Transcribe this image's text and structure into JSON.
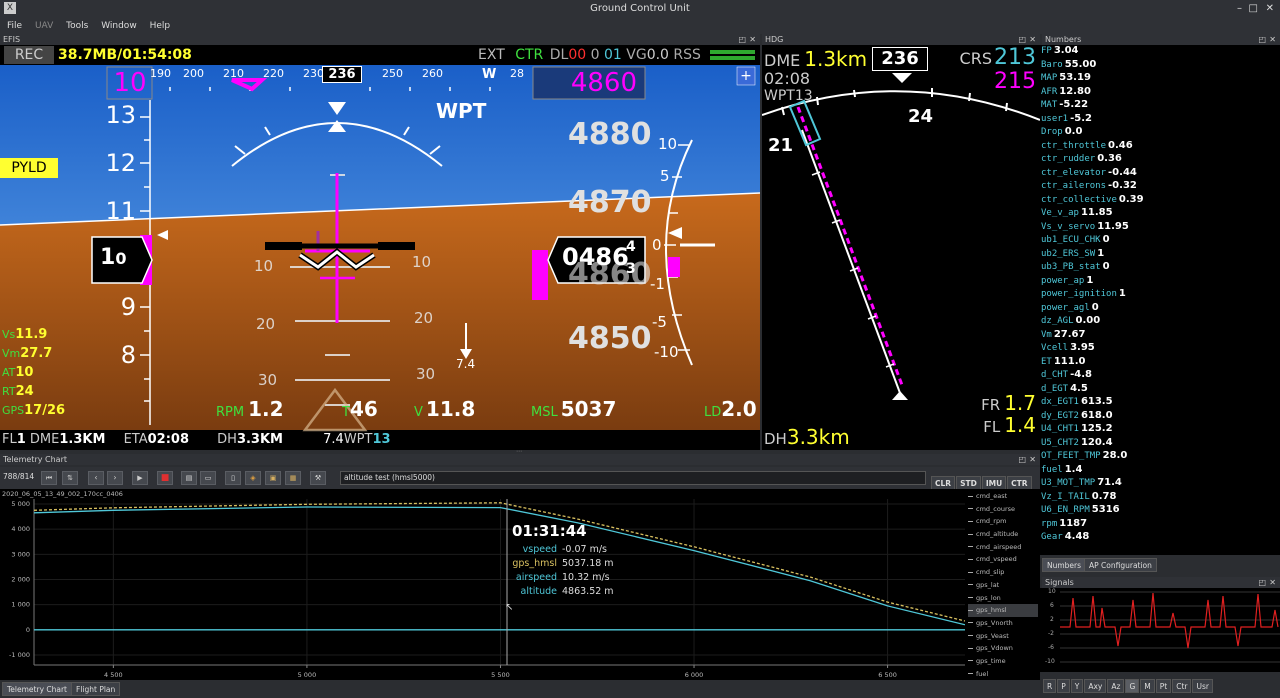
{
  "window": {
    "title": "Ground Control Unit"
  },
  "menu": [
    "File",
    "UAV",
    "Tools",
    "Window",
    "Help"
  ],
  "efis": {
    "panel_title": "EFIS",
    "rec": "REC",
    "rec_info": "38.7MB/01:54:08",
    "status": {
      "ext": "EXT",
      "ctr": "CTR",
      "dl": "DL",
      "dl_val": "00",
      "dl_a": "0",
      "dl_b": "01",
      "vg": "VG",
      "vg_val": "0.0",
      "rss": "RSS"
    },
    "heading_box": "236",
    "course_box": "10",
    "alt_box": "4860",
    "hdg_ticks": [
      "190",
      "200",
      "210",
      "220",
      "230",
      "250",
      "260",
      "W",
      "28"
    ],
    "wpt_label": "WPT",
    "pyld": "PYLD",
    "speed_tape": [
      "13",
      "12",
      "11",
      "9",
      "8"
    ],
    "speed_box_a": "1",
    "speed_box_b": "0",
    "alt_tape": [
      "4880",
      "4870",
      "4860",
      "4850"
    ],
    "alt_box_main": "0486",
    "alt_box_top": "4",
    "alt_box_bot": "3",
    "pitch_labels": [
      "10",
      "10",
      "20",
      "20",
      "30",
      "30"
    ],
    "vs_scale": [
      "10",
      "5",
      "0",
      "-1",
      "-5",
      "-10"
    ],
    "wind": "7.4",
    "left_vals": [
      {
        "k": "Vs",
        "v": "11.9"
      },
      {
        "k": "Vm",
        "v": "27.7"
      },
      {
        "k": "AT",
        "v": "10"
      },
      {
        "k": "RT",
        "v": "24"
      },
      {
        "k": "GPS",
        "v": "17/26"
      }
    ],
    "rpm_label": "RPM",
    "rpm": "1.2",
    "t_label": "T",
    "t_val": "46",
    "v_label": "V",
    "v_val": "11.8",
    "msl_label": "MSL",
    "msl": "5037",
    "ld_label": "LD",
    "ld": "2.0",
    "bottom": {
      "fl": "FL",
      "fl_val": "1",
      "dme": "DME",
      "dme_val": "1.3KM",
      "eta": "ETA",
      "eta_val": "02:08",
      "dh": "DH",
      "dh_val": "3.3KM",
      "wind": "7.4",
      "wpt": "WPT",
      "wpt_val": "13"
    }
  },
  "hdg": {
    "panel_title": "HDG",
    "dme_label": "DME",
    "dme_val": "1.3km",
    "time": "02:08",
    "wpt": "WPT13",
    "heading": "236",
    "crs_label": "CRS",
    "crs": "213",
    "crs2": "215",
    "tick_24": "24",
    "tick_21": "21",
    "fr_label": "FR",
    "fr": "1.7",
    "fl_label": "FL",
    "fl": "1.4",
    "dh_label": "DH",
    "dh": "3.3km"
  },
  "numbers": {
    "panel_title": "Numbers",
    "items": [
      {
        "k": "FP",
        "v": "3.04"
      },
      {
        "k": "Baro",
        "v": "55.00"
      },
      {
        "k": "MAP",
        "v": "53.19"
      },
      {
        "k": "AFR",
        "v": "12.80"
      },
      {
        "k": "MAT",
        "v": "-5.22"
      },
      {
        "k": "user1",
        "v": "-5.2"
      },
      {
        "k": "Drop",
        "v": "0.0"
      },
      {
        "k": "ctr_throttle",
        "v": "0.46"
      },
      {
        "k": "ctr_rudder",
        "v": "0.36"
      },
      {
        "k": "ctr_elevator",
        "v": "-0.44"
      },
      {
        "k": "ctr_ailerons",
        "v": "-0.32"
      },
      {
        "k": "ctr_collective",
        "v": "0.39"
      },
      {
        "k": "Ve_v_ap",
        "v": "11.85"
      },
      {
        "k": "Vs_v_servo",
        "v": "11.95"
      },
      {
        "k": "ub1_ECU_CHK",
        "v": "0"
      },
      {
        "k": "ub2_ERS_SW",
        "v": "1"
      },
      {
        "k": "ub3_PB_stat",
        "v": "0"
      },
      {
        "k": "power_ap",
        "v": "1"
      },
      {
        "k": "power_ignition",
        "v": "1"
      },
      {
        "k": "power_agl",
        "v": "0"
      },
      {
        "k": "dz_AGL",
        "v": "0.00"
      },
      {
        "k": "Vm",
        "v": "27.67"
      },
      {
        "k": "Vcell",
        "v": "3.95"
      },
      {
        "k": "ET",
        "v": "111.0"
      },
      {
        "k": "d_CHT",
        "v": "-4.8"
      },
      {
        "k": "d_EGT",
        "v": "4.5"
      },
      {
        "k": "dx_EGT1",
        "v": "613.5"
      },
      {
        "k": "dy_EGT2",
        "v": "618.0"
      },
      {
        "k": "U4_CHT1",
        "v": "125.2"
      },
      {
        "k": "U5_CHT2",
        "v": "120.4"
      },
      {
        "k": "OT_FEET_TMP",
        "v": "28.0"
      },
      {
        "k": "fuel",
        "v": "1.4"
      },
      {
        "k": "U3_MOT_TMP",
        "v": "71.4"
      },
      {
        "k": "Vz_I_TAIL",
        "v": "0.78"
      },
      {
        "k": "U6_EN_RPM",
        "v": "5316"
      },
      {
        "k": "rpm",
        "v": "1187"
      },
      {
        "k": "Gear",
        "v": "4.48"
      }
    ],
    "tabs": [
      "Numbers",
      "AP Configuration"
    ]
  },
  "signals": {
    "panel_title": "Signals",
    "y_ticks": [
      "10",
      "6",
      "2",
      "-2",
      "-6",
      "-10"
    ],
    "buttons": [
      "R",
      "P",
      "Y",
      "Axy",
      "Az",
      "G",
      "M",
      "Pt",
      "Ctr",
      "Usr"
    ]
  },
  "telemetry": {
    "panel_title": "Telemetry Chart",
    "counter": "788/814",
    "search_value": "altitude test (hmsl5000)",
    "mode_buttons": [
      "CLR",
      "STD",
      "IMU",
      "CTR"
    ],
    "file_name": "2020_06_05_13_49_002_170cc_0406",
    "cursor_time": "01:31:44",
    "tooltip": [
      {
        "k": "vspeed",
        "v": "-0.07 m/s",
        "c": "#4fc7d8"
      },
      {
        "k": "gps_hmsl",
        "v": "5037.18 m",
        "c": "#d8c060"
      },
      {
        "k": "airspeed",
        "v": "10.32 m/s",
        "c": "#4fc7d8"
      },
      {
        "k": "altitude",
        "v": "4863.52 m",
        "c": "#4fc7d8"
      }
    ],
    "legend": [
      "cmd_east",
      "cmd_course",
      "cmd_rpm",
      "cmd_altitude",
      "cmd_airspeed",
      "cmd_vspeed",
      "cmd_slip",
      "gps_lat",
      "gps_lon",
      "gps_hmsl",
      "gps_Vnorth",
      "gps_Veast",
      "gps_Vdown",
      "gps_time",
      "fuel"
    ],
    "bottom_tabs": [
      "Telemetry Chart",
      "Flight Plan"
    ]
  },
  "chart_data": {
    "type": "line",
    "xlabel": "",
    "ylabel": "",
    "x_ticks": [
      "4 500",
      "5 000",
      "5 500",
      "6 000",
      "6 500"
    ],
    "y_ticks": [
      "5 000",
      "4 000",
      "3 000",
      "2 000",
      "1 000",
      "0",
      "-1 000"
    ],
    "xlim": [
      4295,
      6700
    ],
    "ylim": [
      -1400,
      5200
    ],
    "series": [
      {
        "name": "gps_hmsl",
        "color": "#d8c060",
        "x": [
          4295,
          4500,
          5000,
          5500,
          5700,
          6000,
          6300,
          6500,
          6700
        ],
        "y": [
          4750,
          4850,
          4990,
          5050,
          4400,
          3300,
          2100,
          1100,
          350
        ]
      },
      {
        "name": "altitude",
        "color": "#4fc7d8",
        "x": [
          4295,
          4500,
          5000,
          5500,
          5700,
          6000,
          6300,
          6500,
          6700
        ],
        "y": [
          4650,
          4750,
          4880,
          4860,
          4250,
          3150,
          1950,
          950,
          200
        ]
      },
      {
        "name": "vspeed",
        "color": "#4fc7d8",
        "x": [
          4295,
          6700
        ],
        "y": [
          0,
          0
        ]
      }
    ]
  }
}
